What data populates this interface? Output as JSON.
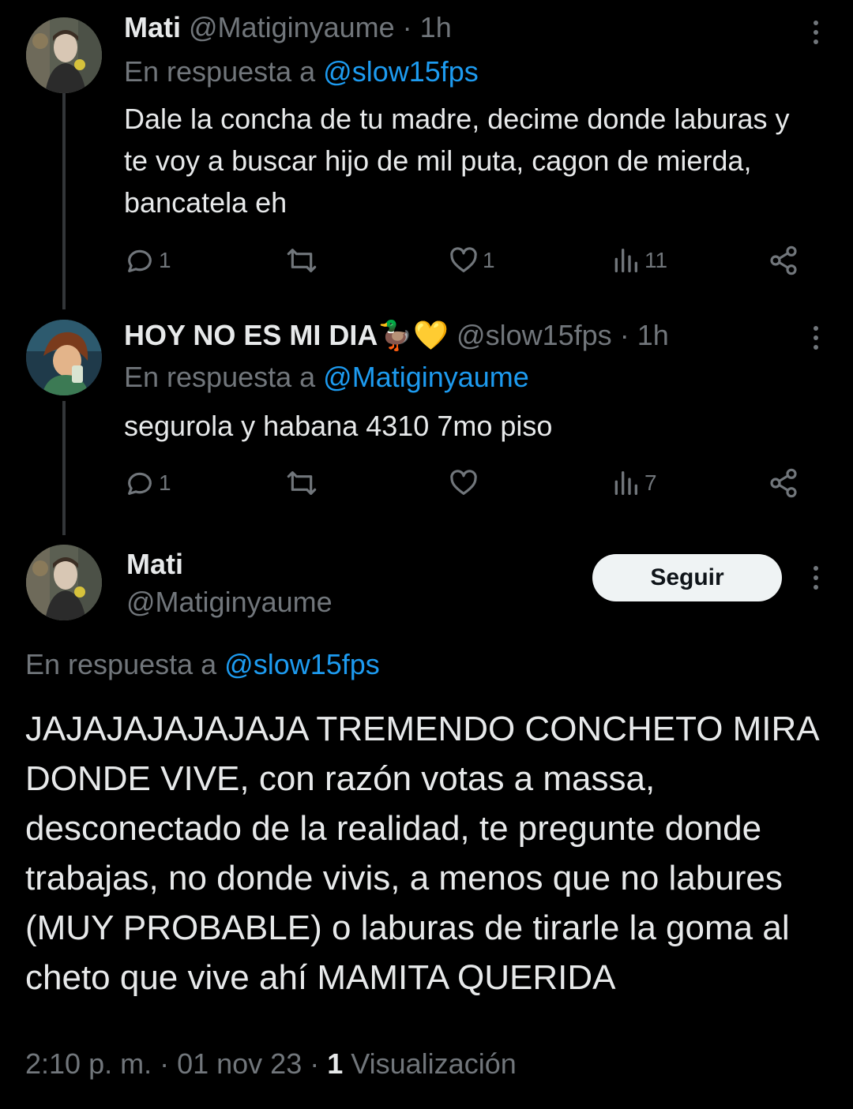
{
  "thread": [
    {
      "name": "Mati",
      "handle": "@Matiginyaume",
      "separator": " · ",
      "time": "1h",
      "reply_prefix": "En respuesta a ",
      "reply_to": "@slow15fps",
      "text": "Dale la concha de tu madre, decime donde laburas y te voy a buscar hijo de mil puta, cagon de mierda, bancatela eh",
      "stats": {
        "replies": "1",
        "retweets": "",
        "likes": "1",
        "views": "11"
      }
    },
    {
      "name": "HOY NO ES MI DIA🦆💛",
      "handle": "@slow15fps",
      "separator": " · ",
      "time": "1h",
      "reply_prefix": "En respuesta a ",
      "reply_to": "@Matiginyaume",
      "text": "segurola y habana 4310 7mo piso",
      "stats": {
        "replies": "1",
        "retweets": "",
        "likes": "",
        "views": "7"
      }
    }
  ],
  "main_tweet": {
    "name": "Mati",
    "handle": "@Matiginyaume",
    "follow_label": "Seguir",
    "reply_prefix": "En respuesta a ",
    "reply_to": "@slow15fps",
    "text": "JAJAJAJAJAJAJA TREMENDO CONCHETO MIRA DONDE VIVE, con razón votas a massa, desconectado de la realidad, te pregunte donde trabajas, no donde vivis,  a menos que no labures (MUY PROBABLE) o laburas de tirarle la goma al cheto que vive ahí MAMITA QUERIDA",
    "time": "2:10 p. m.",
    "date": "01 nov 23",
    "meta_sep": " · ",
    "views_count": "1",
    "views_label": "Visualización"
  },
  "colors": {
    "background": "#000000",
    "text": "#e7e9ea",
    "muted": "#71767b",
    "link": "#1d9bf0",
    "follow_button_bg": "#eff3f4"
  },
  "icons": [
    "more-icon",
    "reply-icon",
    "retweet-icon",
    "like-icon",
    "views-icon",
    "share-icon"
  ]
}
